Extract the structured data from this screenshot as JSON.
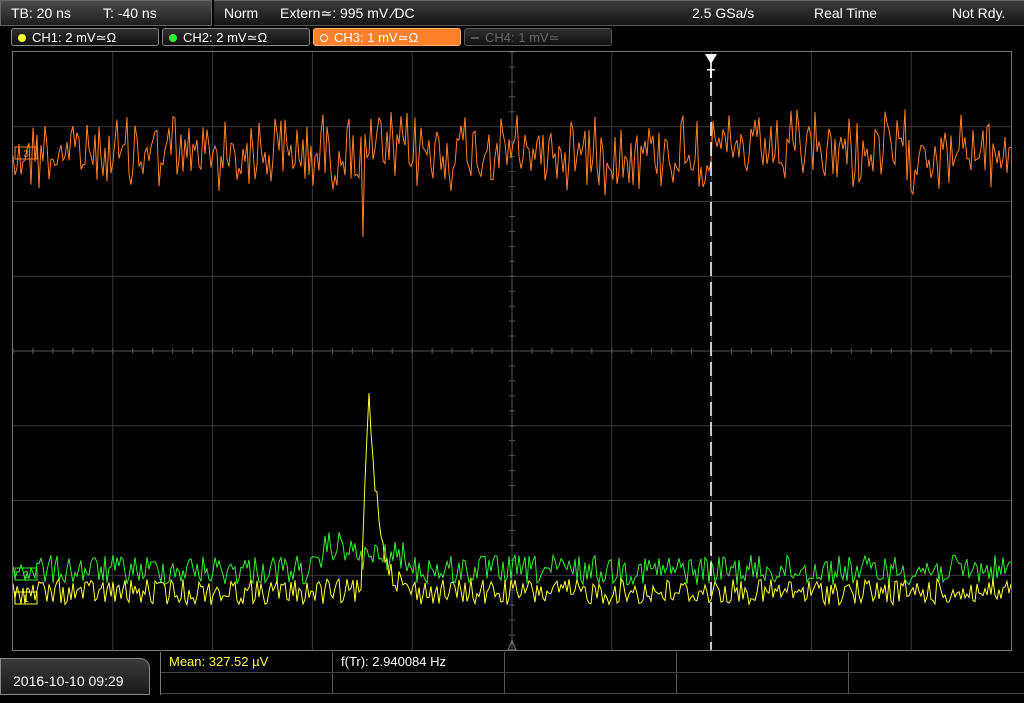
{
  "timebase": {
    "tb": "TB: 20 ns",
    "trig_offset": "T: -40 ns"
  },
  "status": {
    "mode": "Norm",
    "trigger": "Extern≃: 995 mV ∕DC",
    "sample_rate": "2.5 GSa/s",
    "acq": "Real Time",
    "state": "Not Rdy."
  },
  "channels": [
    {
      "label": "CH1: 2 mV≃Ω",
      "color": "#ffff33",
      "state": "on"
    },
    {
      "label": "CH2: 2 mV≃Ω",
      "color": "#33ee33",
      "state": "on"
    },
    {
      "label": "CH3: 1 mV≃Ω",
      "color": "#ff7f2a",
      "state": "active"
    },
    {
      "label": "CH4: 1 mV≃",
      "color": "#666666",
      "state": "off"
    }
  ],
  "trigger_marker": "T",
  "marker_labels": {
    "ch3": "3",
    "ch2": "2",
    "ch1": "1"
  },
  "datetime": "2016-10-10 09:29",
  "measurements": [
    {
      "label": "Mean: 327.52 µV",
      "color": "#ffff33"
    },
    {
      "label": "f(Tr): 2.940084 Hz",
      "color": "#ffffff"
    }
  ]
}
